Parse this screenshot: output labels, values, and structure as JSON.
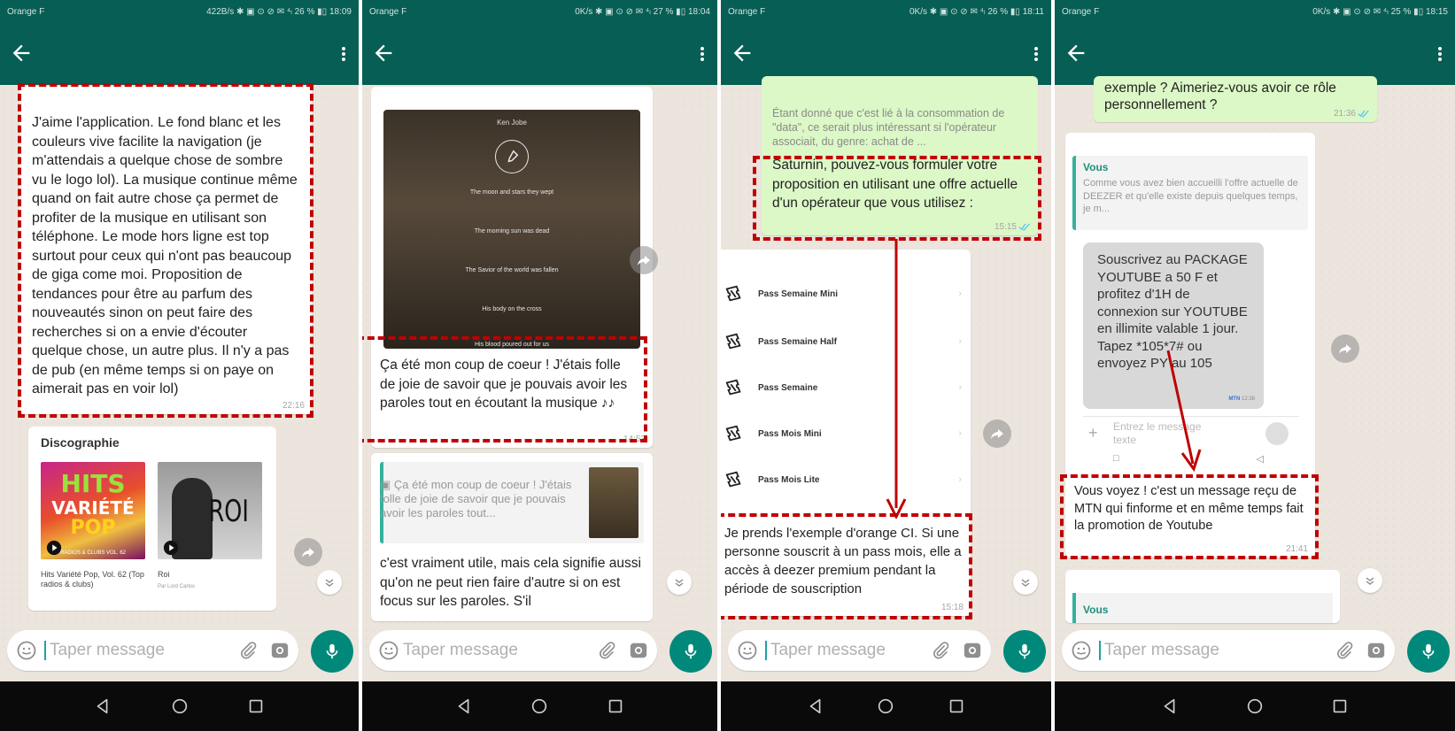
{
  "status_bars": [
    {
      "carrier": "Orange F",
      "right": "422B/s ✱ ▣ ⊙ ⊘ ✉ ⁴ₗ 26 % ▮▯ 18:09"
    },
    {
      "carrier": "Orange F",
      "right": "0K/s ✱ ▣ ⊙ ⊘ ✉ ⁴ₗ 27 % ▮▯ 18:04"
    },
    {
      "carrier": "Orange F",
      "right": "0K/s ✱ ▣ ⊙ ⊘ ✉ ⁴ₗ 26 % ▮▯ 18:11"
    },
    {
      "carrier": "Orange F",
      "right": "0K/s ✱ ▣ ⊙ ⊘ ✉ ⁴ₗ 25 % ▮▯ 18:15"
    }
  ],
  "input": {
    "placeholder": "Taper message"
  },
  "colors": {
    "header": "#075e54",
    "chat_bg": "#ece5dd",
    "outgoing": "#dcf8c6",
    "highlight": "#c00000",
    "arrow": "#c00000",
    "mic": "#00897b"
  },
  "panel1": {
    "message": "J'aime l'application. Le fond blanc et les couleurs vive facilite la navigation (je m'attendais a quelque chose de sombre vu le logo lol). La musique continue même quand on fait autre chose ça permet de profiter de la musique en utilisant son téléphone. Le mode hors ligne est top surtout pour ceux qui n'ont pas beaucoup de giga come moi. Proposition de tendances pour être au parfum des nouveautés sinon on peut faire des recherches si on a envie d'écouter quelque chose, un autre plus. Il n'y a pas de pub (en même temps si on paye on aimerait pas en voir lol)",
    "time": "22:16",
    "discography": {
      "title": "Discographie",
      "albums": [
        {
          "art_lines": [
            "HITS",
            "VARIÉTÉ",
            "POP"
          ],
          "art_sub": "RADIOS & CLUBS VOL. 62",
          "name": "Hits Variété Pop, Vol. 62 (Top radios & clubs)"
        },
        {
          "art_lines": [
            "ROI"
          ],
          "art_sub": "",
          "name": "Roi",
          "artist": "Par Lord Carlos"
        }
      ]
    }
  },
  "panel2": {
    "lyrics_card": {
      "artist": "Ken Jobe",
      "lines": [
        "The moon and stars they wept",
        "The morning sun was dead",
        "The Savior of the world was fallen",
        "His body on the cross",
        "His blood poured out for us"
      ]
    },
    "message": "Ça été  mon coup de coeur ! J'étais folle de joie de savoir que je pouvais avoir les paroles tout en écoutant la musique ♪♪",
    "time": "14:53",
    "quote": "▣ Ça été  mon coup de coeur ! J'étais folle de joie de savoir que je pouvais avoir les paroles tout...",
    "reply": "c'est vraiment utile, mais cela signifie aussi qu'on ne peut rien faire d'autre si on est focus sur les paroles. S'il"
  },
  "panel3": {
    "faded_message": "Étant donné que c'est lié à la consommation de \"data\", ce serait plus intéressant si l'opérateur associait, du genre: achat de ...",
    "question": "Saturnin, pouvez-vous formuler votre proposition en utilisant une offre actuelle d'un opérateur que vous utilisez :",
    "question_time": "15:15",
    "passes": [
      "Pass Semaine Mini",
      "Pass Semaine Half",
      "Pass Semaine",
      "Pass Mois Mini",
      "Pass Mois Lite"
    ],
    "answer": "Je prends l'exemple d'orange CI. Si une personne souscrit à un pass mois, elle a accès à deezer premium  pendant la période de souscription",
    "answer_time": "15:18"
  },
  "panel4": {
    "top_message": "exemple ? Aimeriez-vous avoir ce rôle personnellement ?",
    "top_time": "21:36",
    "quote_author": "Vous",
    "quote_text": "Comme vous avez bien accueilli l'offre actuelle de DEEZER et qu'elle existe depuis quelques temps, je m...",
    "sms": "Souscrivez au PACKAGE YOUTUBE a 50 F et profitez d'1H de connexion sur YOUTUBE en illimite valable 1 jour. Tapez *105*7# ou envoyez PY au 105",
    "sms_sender": "MTN",
    "sms_time": "12:38",
    "sms_input_placeholder": "Entrez le message texte",
    "caption": "Vous voyez ! c'est un message reçu de MTN qui finforme et en même temps fait la promotion de Youtube",
    "caption_time": "21:41",
    "bottom_author": "Vous"
  }
}
